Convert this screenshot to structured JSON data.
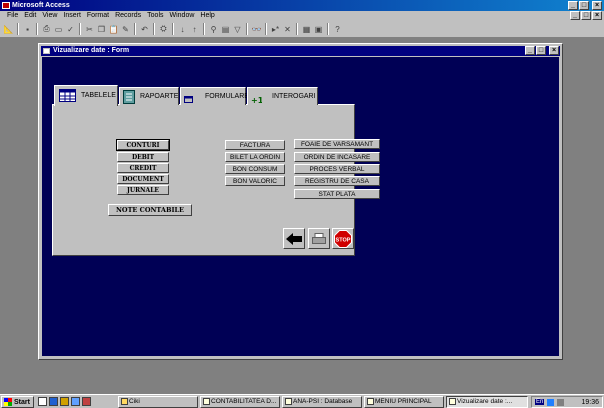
{
  "app": {
    "title": "Microsoft Access"
  },
  "menubar": {
    "items": [
      "File",
      "Edit",
      "View",
      "Insert",
      "Format",
      "Records",
      "Tools",
      "Window",
      "Help"
    ]
  },
  "window": {
    "title": "Vizualizare date : Form"
  },
  "tabs": [
    {
      "label": "TABELELE",
      "icon": "table-icon",
      "active": true
    },
    {
      "label": "RAPOARTE",
      "icon": "report-icon",
      "active": false
    },
    {
      "label": "FORMULARE",
      "icon": "form-icon",
      "active": false
    },
    {
      "label": "INTEROGARI",
      "icon": "query-icon",
      "active": false
    }
  ],
  "left_buttons": [
    "CONTURI",
    "DEBIT",
    "CREDIT",
    "DOCUMENT",
    "JURNALE"
  ],
  "note_button": "NOTE CONTABILE",
  "middle_buttons": [
    "FACTURA",
    "BILET LA ORDIN",
    "BON CONSUM",
    "BON VALORIC"
  ],
  "right_buttons": [
    "FOAIE DE VARSAMANT",
    "ORDIN DE INCASARE",
    "PROCES VERBAL",
    "REGISTRU DE CASA",
    "STAT PLATA"
  ],
  "action_buttons": [
    {
      "name": "back-arrow-icon"
    },
    {
      "name": "print-icon"
    },
    {
      "name": "stop-icon",
      "label": "STOP"
    }
  ],
  "taskbar": {
    "start": "Start",
    "tasks": [
      {
        "label": "Ciki",
        "active": false
      },
      {
        "label": "CONTABILITATEA D...",
        "active": false
      },
      {
        "label": "ANA-PSI : Database",
        "active": false
      },
      {
        "label": "MENIU PRINCIPAL",
        "active": false
      },
      {
        "label": "Vizualizare date :...",
        "active": true
      }
    ],
    "lang": "En",
    "clock": "19:36"
  },
  "colors": {
    "form_background": "#000055",
    "title_bar": "#000080",
    "face": "#c0c0c0",
    "stop": "#d00000"
  }
}
